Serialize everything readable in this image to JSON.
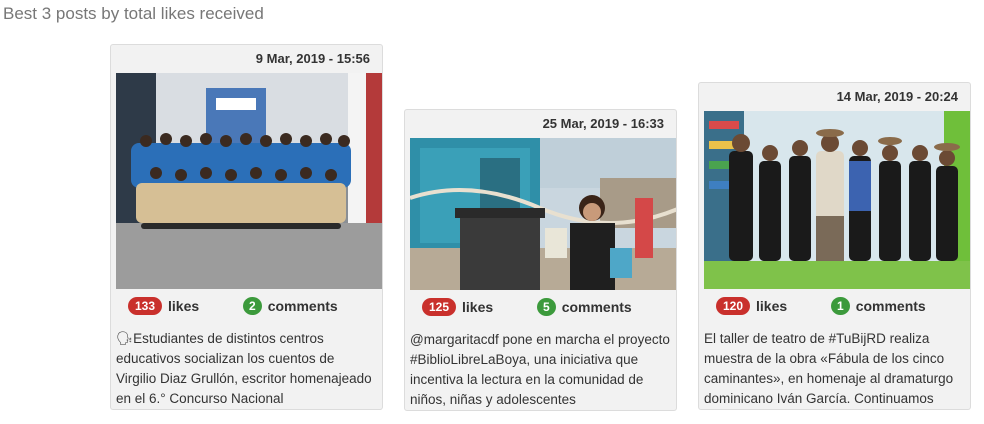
{
  "section_title": "Best 3 posts by total likes received",
  "posts": [
    {
      "date": "9 Mar, 2019 - 15:56",
      "likes": "133",
      "likes_label": "likes",
      "comments": "2",
      "comments_label": "comments",
      "text": "🗣Estudiantes de distintos centros educativos socializan los cuentos de Virgilio Diaz Grullón, escritor homenajeado en el 6.° Concurso Nacional"
    },
    {
      "date": "25 Mar, 2019 - 16:33",
      "likes": "125",
      "likes_label": "likes",
      "comments": "5",
      "comments_label": "comments",
      "text": "@margaritacdf pone en marcha el proyecto #BiblioLibreLaBoya, una iniciativa que incentiva la lectura en la comunidad de niños, niñas y adolescentes"
    },
    {
      "date": "14 Mar, 2019 - 20:24",
      "likes": "120",
      "likes_label": "likes",
      "comments": "1",
      "comments_label": "comments",
      "text": "El taller de teatro de #TuBijRD realiza muestra de la obra «Fábula de los cinco caminantes», en homenaje al dramaturgo dominicano Iván García. Continuamos"
    }
  ],
  "colors": {
    "likes_badge": "#c9302c",
    "comments_badge": "#3c9a3c",
    "card_bg": "#f2f2f2"
  }
}
